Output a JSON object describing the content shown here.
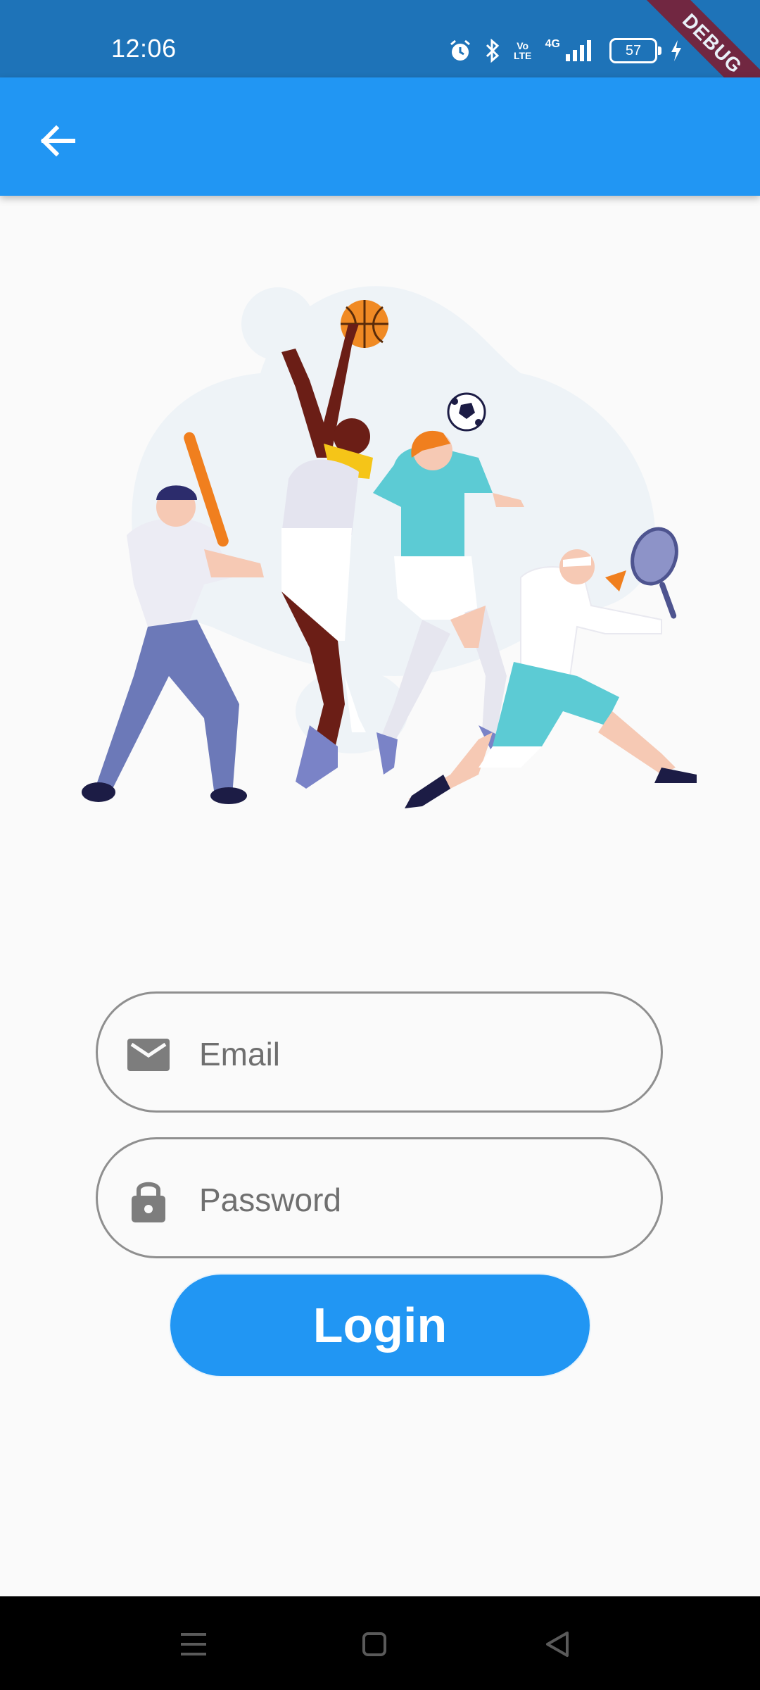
{
  "status_bar": {
    "time": "12:06",
    "battery_level": "57",
    "network_label": "4G",
    "volte_label": "Vo LTE",
    "icons": [
      "alarm-icon",
      "bluetooth-icon",
      "volte-icon",
      "signal-icon",
      "battery-icon",
      "charging-icon"
    ]
  },
  "debug_banner": {
    "label": "DEBUG",
    "color": "#7b1f35"
  },
  "app_bar": {
    "back_icon": "arrow-left-icon",
    "color": "#2196f3"
  },
  "illustration": {
    "description_icon": "sports-players-illustration"
  },
  "form": {
    "email": {
      "placeholder": "Email",
      "value": "",
      "icon": "mail-icon"
    },
    "password": {
      "placeholder": "Password",
      "value": "",
      "icon": "lock-icon"
    },
    "login_label": "Login"
  },
  "nav_bar": {
    "icons": [
      "menu-icon",
      "home-square-icon",
      "back-triangle-icon"
    ]
  },
  "colors": {
    "primary": "#2196f3",
    "status_bar": "#1e73b8",
    "background": "#fafafa"
  }
}
